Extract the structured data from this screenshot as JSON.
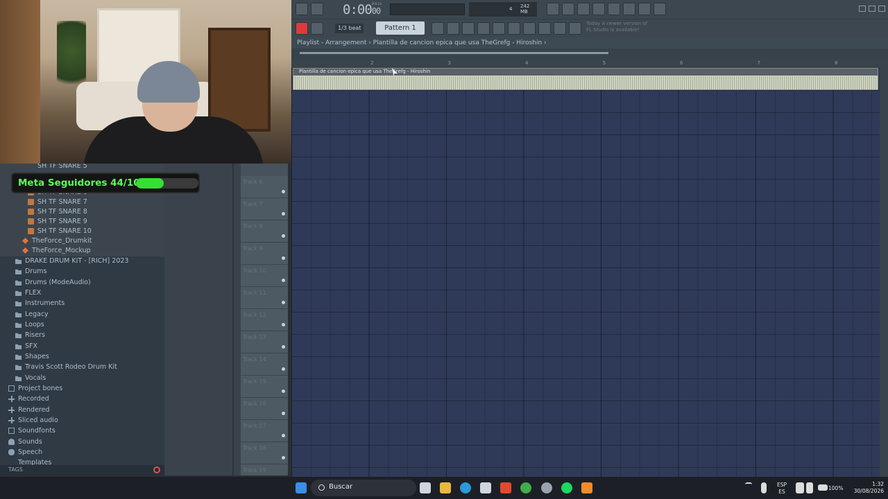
{
  "browser": {
    "items_upper": [
      "SH TF SNARE 5",
      "SH TF SNARE 6",
      "SH TF SNARE 7",
      "SH TF SNARE 8",
      "SH TF SNARE 9",
      "SH TF SNARE 10"
    ],
    "fl_projects": [
      "TheForce_Drumkit",
      "TheForce_Mockup"
    ],
    "folders": [
      "DRAKE DRUM KIT - [RICH] 2023",
      "Drums",
      "Drums (ModeAudio)",
      "FLEX",
      "Instruments",
      "Legacy",
      "Loops",
      "Risers",
      "SFX",
      "Shapes",
      "Travis Scott Rodeo Drum Kit",
      "Vocals"
    ],
    "root": [
      "Project bones",
      "Recorded",
      "Rendered",
      "Sliced audio",
      "Soundfonts",
      "Sounds",
      "Speech",
      "Templates"
    ],
    "tags_label": "TAGS"
  },
  "overlay": {
    "goal_text": "Meta Seguidores 44/100",
    "goal_fraction": 0.44
  },
  "toolbar": {
    "time": "0:00",
    "time_small": "00",
    "time_label": "M:S:CS",
    "memory": "242 MB",
    "cpu_value": "4",
    "snap": "1/3 beat",
    "pattern": "Pattern 1",
    "news": "Today  A newer version of FL Studio is available!"
  },
  "playlist": {
    "title": "Playlist - Arrangement  ›  Plantilla de cancion epica que usa TheGrefg - Hiroshin  ›",
    "clip_name": "Plantilla de cancion epica que usa TheGrefg - Hiroshin",
    "bars": [
      "2",
      "3",
      "4",
      "5",
      "6",
      "7",
      "8"
    ],
    "tracks": [
      "Track 6",
      "Track 7",
      "Track 8",
      "Track 9",
      "Track 10",
      "Track 11",
      "Track 12",
      "Track 13",
      "Track 14",
      "Track 15",
      "Track 16",
      "Track 17",
      "Track 18",
      "Track 19"
    ]
  },
  "taskbar": {
    "search": "Buscar",
    "lang_top": "ESP",
    "lang_bottom": "ES",
    "battery": "100%",
    "time": "1:32",
    "date": "30/08/2026"
  },
  "colors": {
    "goal_green": "#5cff5c",
    "record_red": "#e0393d",
    "grid": "#2f3a58"
  }
}
